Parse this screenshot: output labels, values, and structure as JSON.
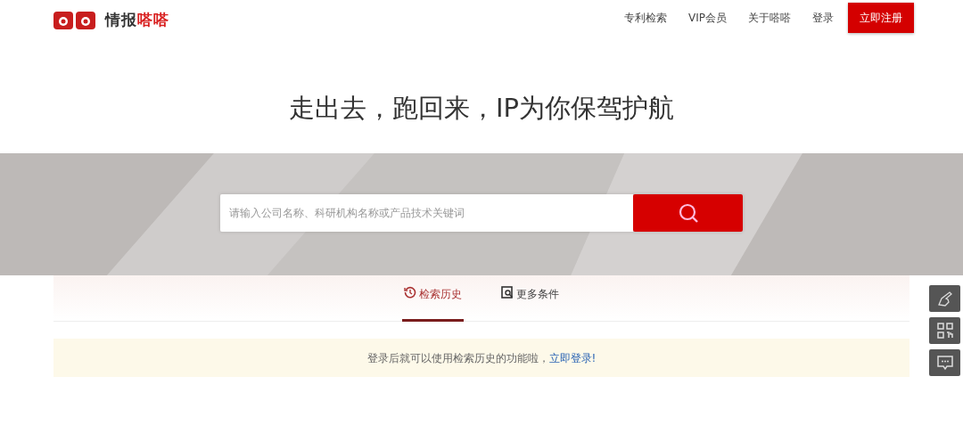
{
  "logo": {
    "name": "情报",
    "accent": "嗒嗒"
  },
  "nav": [
    {
      "label": "专利检索",
      "kind": "link"
    },
    {
      "label": "VIP会员",
      "kind": "link"
    },
    {
      "label": "关于嗒嗒",
      "kind": "link"
    },
    {
      "label": "登录",
      "kind": "link"
    },
    {
      "label": "立即注册",
      "kind": "primary"
    }
  ],
  "headline": "走出去，跑回来，IP为你保驾护航",
  "search": {
    "placeholder": "请输入公司名称、科研机构名称或产品技术关键词"
  },
  "tabs": [
    {
      "label": "检索历史",
      "selected": true,
      "kind": "history"
    },
    {
      "label": "更多条件",
      "selected": false,
      "kind": "filter"
    }
  ],
  "notice": {
    "text": "登录后就可以使用检索历史的功能啦，",
    "link": "立即登录!"
  },
  "side_buttons": [
    {
      "kind": "hand"
    },
    {
      "kind": "qr"
    },
    {
      "kind": "chat"
    }
  ]
}
